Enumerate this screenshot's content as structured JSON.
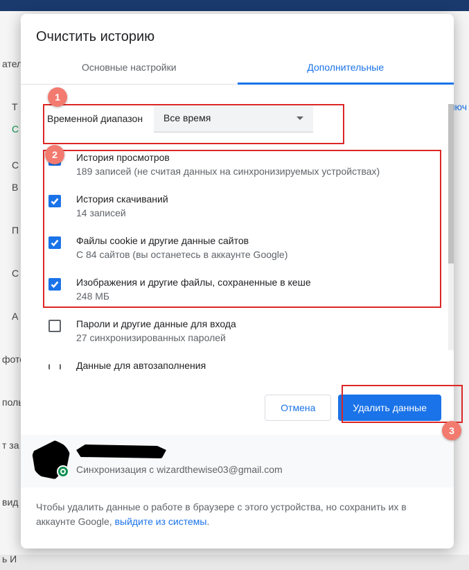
{
  "dialog": {
    "title": "Очистить историю",
    "tabs": {
      "basic": "Основные настройки",
      "advanced": "Дополнительные"
    },
    "time_range_label": "Временной диапазон",
    "time_range_value": "Все время",
    "items": [
      {
        "title": "История просмотров",
        "sub": "189 записей (не считая данных на синхронизируемых устройствах)",
        "checked": true
      },
      {
        "title": "История скачиваний",
        "sub": "14 записей",
        "checked": true
      },
      {
        "title": "Файлы cookie и другие данные сайтов",
        "sub": "С 84 сайтов (вы останетесь в аккаунте Google)",
        "checked": true
      },
      {
        "title": "Изображения и другие файлы, сохраненные в кеше",
        "sub": "248 МБ",
        "checked": true
      },
      {
        "title": "Пароли и другие данные для входа",
        "sub": "27 синхронизированных паролей",
        "checked": false
      },
      {
        "title": "Данные для автозаполнения",
        "sub": "",
        "checked": false
      }
    ],
    "buttons": {
      "cancel": "Отмена",
      "delete": "Удалить данные"
    },
    "account": {
      "sync_text": "Синхронизация с wizardthewise03@gmail.com"
    },
    "footer": {
      "text_before": "Чтобы удалить данные о работе в браузере с этого устройства, но сохранить их в аккаунте Google, ",
      "link": "выйдите из системы",
      "text_after": "."
    }
  },
  "annotations": {
    "badge1": "1",
    "badge2": "2",
    "badge3": "3"
  },
  "backdrop": {
    "t1": "атель",
    "t2": "T",
    "t3": "С",
    "t4": "люч",
    "t5": "С",
    "t6": "В",
    "t7": "П",
    "t8": "С",
    "t9": "А",
    "t10": "фото",
    "t11": "поль",
    "t12": "т за",
    "t13": "вид",
    "t14": "ь И"
  }
}
